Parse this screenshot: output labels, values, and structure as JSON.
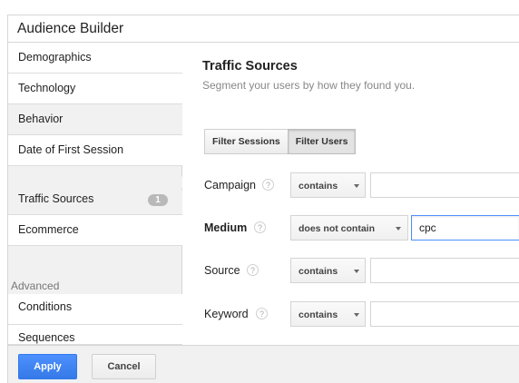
{
  "window": {
    "title": "Audience Builder"
  },
  "sidebar": {
    "items": [
      {
        "label": "Demographics"
      },
      {
        "label": "Technology"
      },
      {
        "label": "Behavior"
      },
      {
        "label": "Date of First Session"
      },
      {
        "label": "Traffic Sources",
        "badge": "1"
      },
      {
        "label": "Ecommerce"
      }
    ],
    "advanced_heading": "Advanced",
    "advanced_items": [
      {
        "label": "Conditions"
      },
      {
        "label": "Sequences"
      }
    ]
  },
  "main": {
    "title": "Traffic Sources",
    "subtitle": "Segment your users by how they found you.",
    "filter_toggle": {
      "sessions_label": "Filter Sessions",
      "users_label": "Filter Users",
      "selected": "Filter Users"
    },
    "rows": [
      {
        "label": "Campaign",
        "help": "?",
        "operator": "contains",
        "value": ""
      },
      {
        "label": "Medium",
        "help": "?",
        "operator": "does not contain",
        "value": "cpc"
      },
      {
        "label": "Source",
        "help": "?",
        "operator": "contains",
        "value": ""
      },
      {
        "label": "Keyword",
        "help": "?",
        "operator": "contains",
        "value": ""
      }
    ]
  },
  "footer": {
    "apply_label": "Apply",
    "cancel_label": "Cancel"
  },
  "colors": {
    "accent": "#4d90fe",
    "sidebar_bg": "#f1f1f1",
    "badge_bg": "#b9b9b9"
  }
}
